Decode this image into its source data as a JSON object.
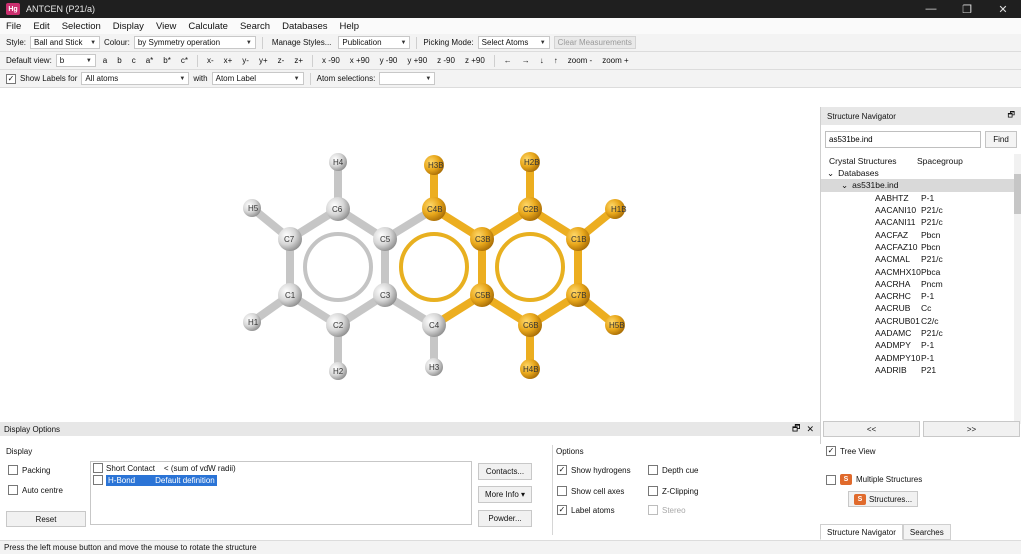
{
  "window": {
    "app_icon": "Hg",
    "title": "ANTCEN (P21/a)",
    "controls": {
      "minimize": "—",
      "restore": "❐",
      "close": "✕"
    }
  },
  "menu": [
    "File",
    "Edit",
    "Selection",
    "Display",
    "View",
    "Calculate",
    "Search",
    "Databases",
    "Help"
  ],
  "toolbar1": {
    "style_label": "Style:",
    "style_value": "Ball and Stick",
    "colour_label": "Colour:",
    "colour_value": "by Symmetry operation",
    "manage_styles": "Manage Styles...",
    "publication_value": "Publication",
    "picking_label": "Picking Mode:",
    "picking_value": "Select Atoms",
    "clear_measurements": "Clear Measurements"
  },
  "toolbar2": {
    "default_view_label": "Default view:",
    "default_view_value": "b",
    "view_buttons": [
      "a",
      "b",
      "c",
      "a*",
      "b*",
      "c*",
      "x-",
      "x+",
      "y-",
      "y+",
      "z-",
      "z+",
      "x -90",
      "x +90",
      "y -90",
      "y +90",
      "z -90",
      "z +90",
      "←",
      "→",
      "↓",
      "↑",
      "zoom -",
      "zoom +"
    ]
  },
  "toolbar3": {
    "show_labels_label": "Show Labels for",
    "show_labels_value": "All atoms",
    "with_label": "with",
    "with_value": "Atom Label",
    "atom_selections_label": "Atom selections:",
    "atom_selections_value": ""
  },
  "molecule": {
    "grey_color": "#d9d9d9",
    "orange_color": "#e8a71b",
    "bond_grey": "#c8c8c8",
    "bond_orange": "#ecae20",
    "atom_labels": [
      "H4",
      "H3B",
      "H2B",
      "H5",
      "C6",
      "C4B",
      "C2B",
      "H1B",
      "C7",
      "C5",
      "C3B",
      "C1B",
      "C1",
      "C3",
      "C5B",
      "C7B",
      "H1",
      "C2",
      "C4",
      "C6B",
      "H5B",
      "H2",
      "H3",
      "H4B"
    ]
  },
  "navigator": {
    "header_title": "Structure Navigator",
    "search_value": "as531be.ind",
    "find_label": "Find",
    "col_crystal": "Crystal Structures",
    "col_spacegroup": "Spacegroup",
    "databases_label": "Databases",
    "db_file_label": "as531be.ind",
    "entries": [
      {
        "code": "AABHTZ",
        "sg": "P-1"
      },
      {
        "code": "AACANI10",
        "sg": "P21/c"
      },
      {
        "code": "AACANI11",
        "sg": "P21/c"
      },
      {
        "code": "AACFAZ",
        "sg": "Pbcn"
      },
      {
        "code": "AACFAZ10",
        "sg": "Pbcn"
      },
      {
        "code": "AACMAL",
        "sg": "P21/c"
      },
      {
        "code": "AACMHX10",
        "sg": "Pbca"
      },
      {
        "code": "AACRHA",
        "sg": "Pncm"
      },
      {
        "code": "AACRHC",
        "sg": "P-1"
      },
      {
        "code": "AACRUB",
        "sg": "Cc"
      },
      {
        "code": "AACRUB01",
        "sg": "C2/c"
      },
      {
        "code": "AADAMC",
        "sg": "P21/c"
      },
      {
        "code": "AADMPY",
        "sg": "P-1"
      },
      {
        "code": "AADMPY10",
        "sg": "P-1"
      },
      {
        "code": "AADRIB",
        "sg": "P21"
      }
    ],
    "prev_label": "<<",
    "next_label": ">>",
    "tree_view_label": "Tree View",
    "multiple_structures_label": "Multiple Structures",
    "structures_button": "Structures...",
    "tab_navigator": "Structure Navigator",
    "tab_searches": "Searches"
  },
  "display_options": {
    "panel_title": "Display Options",
    "display_section": "Display",
    "packing_label": "Packing",
    "auto_centre_label": "Auto centre",
    "reset_button": "Reset",
    "short_contact_label": "Short Contact",
    "short_contact_def": "< (sum of vdW radii)",
    "hbond_label": "H-Bond",
    "hbond_def": "Default definition",
    "contacts_button": "Contacts...",
    "more_info_button": "More Info ▾",
    "powder_button": "Powder...",
    "options_section": "Options",
    "show_hydrogens": "Show hydrogens",
    "depth_cue": "Depth cue",
    "show_cell_axes": "Show cell axes",
    "z_clipping": "Z-Clipping",
    "label_atoms": "Label atoms",
    "stereo": "Stereo"
  },
  "status": "Press the left mouse button and move the mouse to rotate the structure"
}
